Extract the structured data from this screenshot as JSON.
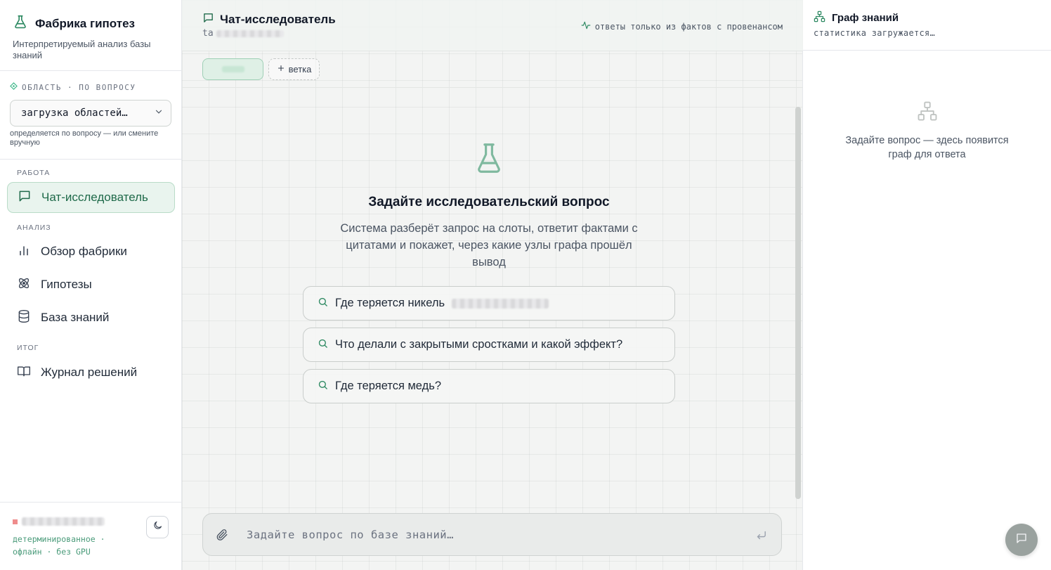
{
  "app": {
    "title": "Фабрика гипотез",
    "subtitle": "Интерпретируемый анализ базы знаний"
  },
  "scope": {
    "label": "ОБЛАСТЬ · ПО ВОПРОСУ",
    "select_value": "загрузка областей…",
    "hint": "определяется по вопросу — или смените вручную"
  },
  "nav": {
    "group_work": "РАБОТА",
    "group_analysis": "АНАЛИЗ",
    "group_result": "ИТОГ",
    "items": [
      {
        "label": "Чат-исследователь",
        "icon": "chat-icon",
        "active": true
      },
      {
        "label": "Обзор фабрики",
        "icon": "bar-chart-icon",
        "active": false
      },
      {
        "label": "Гипотезы",
        "icon": "atom-icon",
        "active": false
      },
      {
        "label": "База знаний",
        "icon": "database-icon",
        "active": false
      },
      {
        "label": "Журнал решений",
        "icon": "book-icon",
        "active": false
      }
    ]
  },
  "footer": {
    "status_line1": "детерминированное ·",
    "status_line2": "офлайн · без GPU"
  },
  "chat": {
    "title": "Чат-исследователь",
    "subtitle_prefix": "ta",
    "provenance_note": "ответы только из фактов с провенансом",
    "add_branch_label": "ветка",
    "empty_title": "Задайте исследовательский вопрос",
    "empty_description": "Система разберёт запрос на слоты, ответит фактами с цитатами и покажет, через какие узлы графа прошёл вывод",
    "suggestions": [
      "Где теряется никель",
      "Что делали с закрытыми сростками и какой эффект?",
      "Где теряется медь?"
    ],
    "input_placeholder": "Задайте вопрос по базе знаний…"
  },
  "graph_panel": {
    "title": "Граф знаний",
    "status": "статистика загружается…",
    "empty_text": "Задайте вопрос — здесь появится граф для ответа"
  },
  "colors": {
    "accent": "#2f8a63",
    "accent_light": "#e9f4ee",
    "status_text": "#4a9b7a"
  }
}
